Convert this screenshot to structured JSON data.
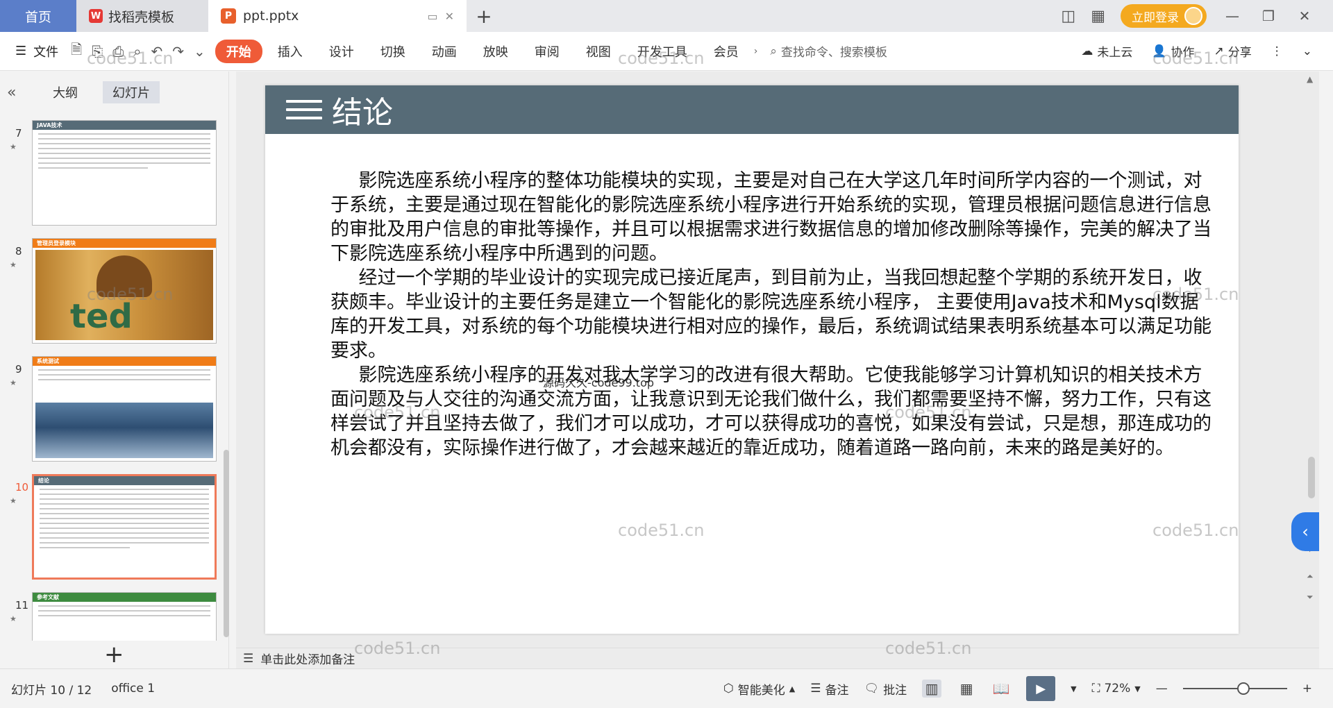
{
  "tabs": {
    "home": "首页",
    "template": "找稻壳模板",
    "doc_title": "ppt.pptx",
    "add": "+"
  },
  "titlebar": {
    "login": "立即登录"
  },
  "toolbar": {
    "file": "文件",
    "menu": [
      "开始",
      "插入",
      "设计",
      "切换",
      "动画",
      "放映",
      "审阅",
      "视图",
      "开发工具",
      "会员"
    ],
    "search_placeholder": "查找命令、搜索模板",
    "cloud": "未上云",
    "collab": "协作",
    "share": "分享"
  },
  "left_panel": {
    "tab_outline": "大纲",
    "tab_slides": "幻灯片",
    "slides": [
      {
        "num": "7",
        "title": "JAVA技术",
        "color": "#566b77"
      },
      {
        "num": "8",
        "title": "管理员登录模块",
        "color": "#f07c17"
      },
      {
        "num": "9",
        "title": "系统测试",
        "color": "#f07c17"
      },
      {
        "num": "10",
        "title": "结论",
        "color": "#566b77"
      },
      {
        "num": "11",
        "title": "参考文献",
        "color": "#3d8b3f"
      }
    ],
    "bear_text": "ted"
  },
  "slide": {
    "title": "结论",
    "paragraphs": [
      "影院选座系统小程序的整体功能模块的实现，主要是对自己在大学这几年时间所学内容的一个测试，对于系统，主要是通过现在智能化的影院选座系统小程序进行开始系统的实现，管理员根据问题信息进行信息的审批及用户信息的审批等操作，并且可以根据需求进行数据信息的增加修改删除等操作，完美的解决了当下影院选座系统小程序中所遇到的问题。",
      "经过一个学期的毕业设计的实现完成已接近尾声，到目前为止，当我回想起整个学期的系统开发日，收获颇丰。毕业设计的主要任务是建立一个智能化的影院选座系统小程序， 主要使用Java技术和Mysql数据库的开发工具，对系统的每个功能模块进行相对应的操作，最后，系统调试结果表明系统基本可以满足功能要求。",
      "影院选座系统小程序的开发对我大学学习的改进有很大帮助。它使我能够学习计算机知识的相关技术方面问题及与人交往的沟通交流方面，让我意识到无论我们做什么，我们都需要坚持不懈，努力工作，只有这样尝试了并且坚持去做了，我们才可以成功，才可以获得成功的喜悦，如果没有尝试，只是想，那连成功的机会都没有，实际操作进行做了，才会越来越近的靠近成功，随着道路一路向前，未来的路是美好的。"
    ],
    "overlay_text": "源码久久-code99.top"
  },
  "notes": {
    "placeholder": "单击此处添加备注"
  },
  "status": {
    "slide_info": "幻灯片 10 / 12",
    "theme": "office 1",
    "beautify": "智能美化",
    "notes": "备注",
    "comment": "批注",
    "zoom": "72%"
  },
  "watermarks": [
    "code51.cn"
  ]
}
